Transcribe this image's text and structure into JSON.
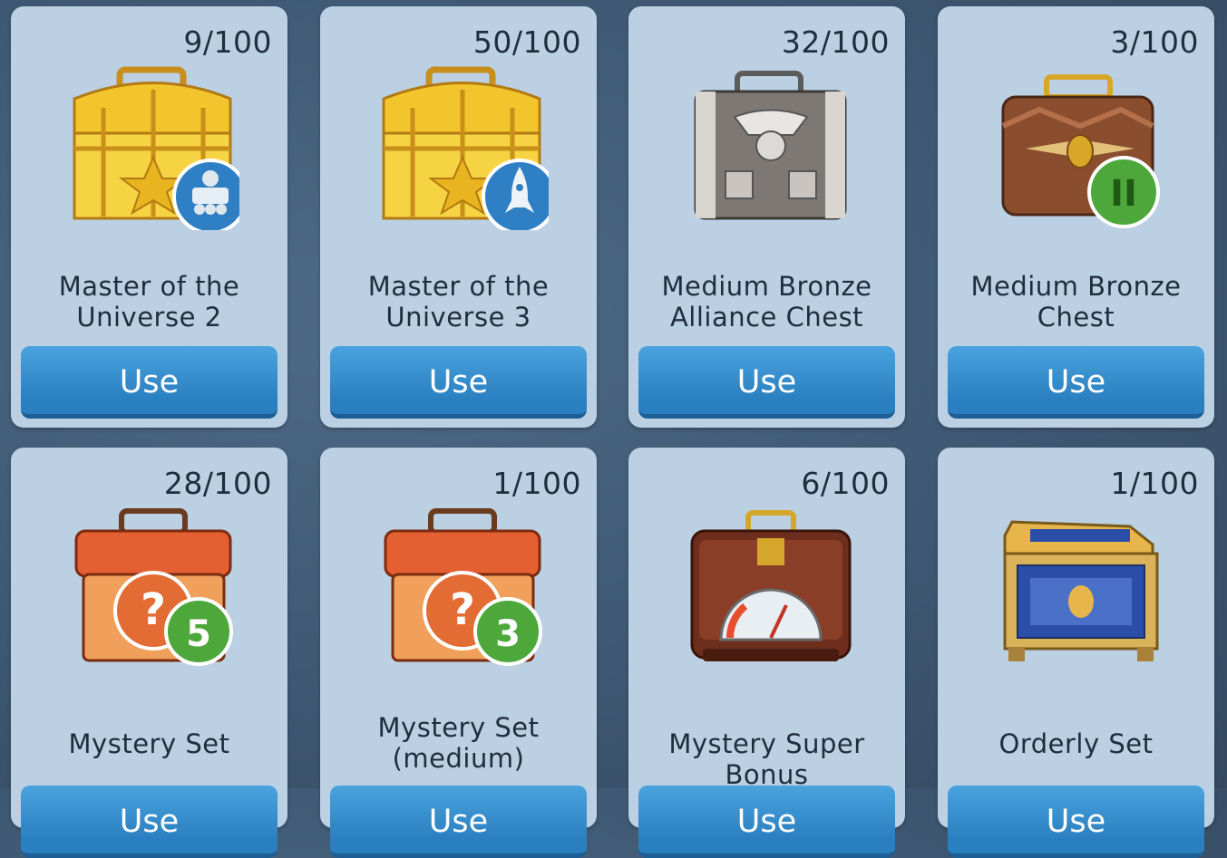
{
  "items": [
    {
      "count": "9/100",
      "name": "Master of the\nUniverse 2",
      "button": "Use",
      "badge": "rover-icon"
    },
    {
      "count": "50/100",
      "name": "Master of the\nUniverse 3",
      "button": "Use",
      "badge": "rocket-icon"
    },
    {
      "count": "32/100",
      "name": "Medium Bronze\nAlliance Chest",
      "button": "Use"
    },
    {
      "count": "3/100",
      "name": "Medium Bronze\nChest",
      "button": "Use",
      "badge": "II"
    },
    {
      "count": "28/100",
      "name": "Mystery Set",
      "button": "Use",
      "badge": "5"
    },
    {
      "count": "1/100",
      "name": "Mystery Set\n(medium)",
      "button": "Use",
      "badge": "3"
    },
    {
      "count": "6/100",
      "name": "Mystery Super Bonus",
      "button": "Use"
    },
    {
      "count": "1/100",
      "name": "Orderly Set",
      "button": "Use"
    }
  ],
  "colors": {
    "card": "#bcd0e3",
    "button": "#2f86c6",
    "text": "#1f2e3d"
  }
}
